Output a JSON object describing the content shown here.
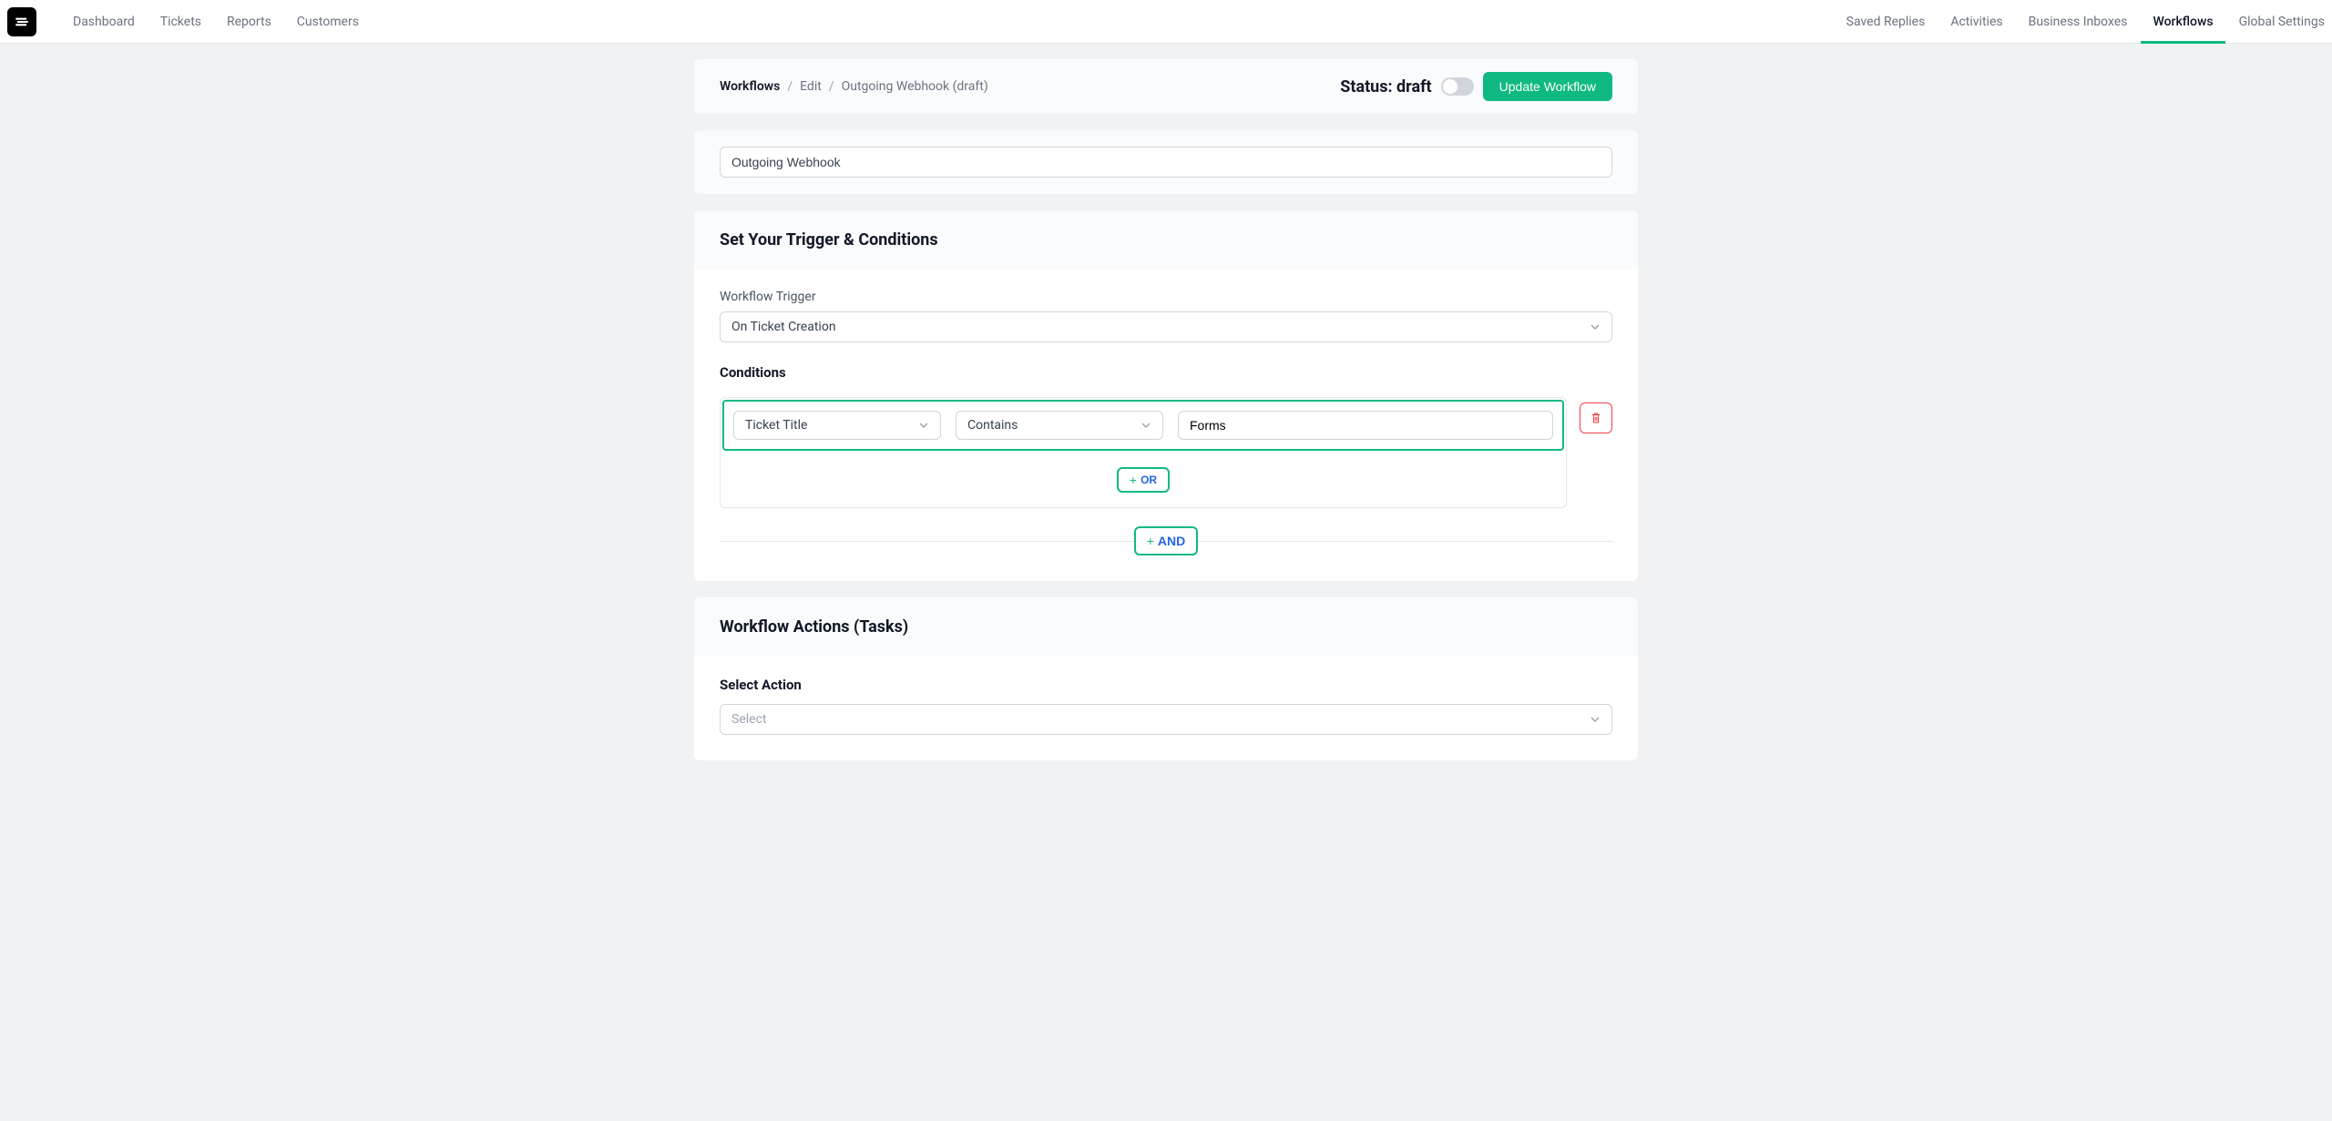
{
  "nav": {
    "left": [
      "Dashboard",
      "Tickets",
      "Reports",
      "Customers"
    ],
    "right": [
      "Saved Replies",
      "Activities",
      "Business Inboxes",
      "Workflows",
      "Global Settings"
    ],
    "active": "Workflows"
  },
  "breadcrumb": {
    "items": [
      "Workflows",
      "Edit",
      "Outgoing Webhook (draft)"
    ],
    "currentIndex": 0
  },
  "status": {
    "label": "Status: draft",
    "enabled": false
  },
  "buttons": {
    "update": "Update Workflow",
    "or": "OR",
    "and": "AND"
  },
  "workflow": {
    "name": "Outgoing Webhook"
  },
  "sections": {
    "trigger": {
      "title": "Set Your Trigger & Conditions",
      "triggerLabel": "Workflow Trigger",
      "triggerValue": "On Ticket Creation",
      "conditionsLabel": "Conditions",
      "condition": {
        "field": "Ticket Title",
        "operator": "Contains",
        "value": "Forms"
      }
    },
    "actions": {
      "title": "Workflow Actions (Tasks)",
      "selectLabel": "Select Action",
      "selectPlaceholder": "Select"
    }
  }
}
